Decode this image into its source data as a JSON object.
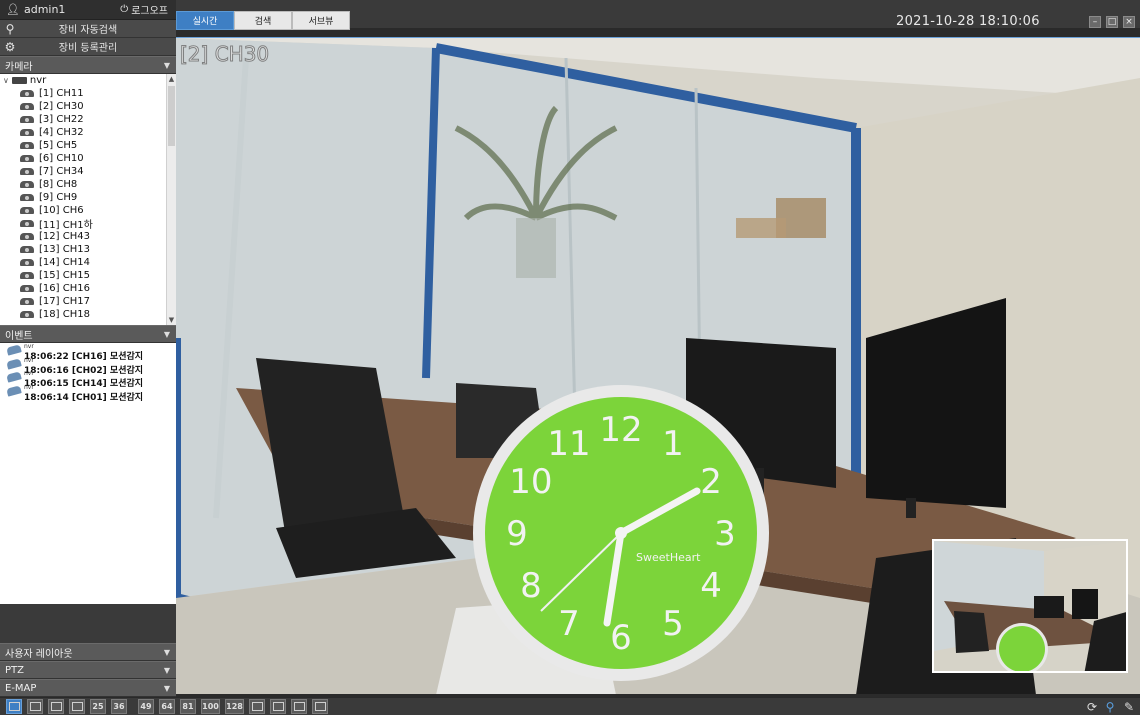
{
  "user": {
    "name": "admin1",
    "logout": "로그오프"
  },
  "menu": [
    {
      "label": "장비 자동검색",
      "icon": "search-icon"
    },
    {
      "label": "장비 등록관리",
      "icon": "gear-icon"
    }
  ],
  "camera": {
    "header": "카메라",
    "root": "nvr",
    "items": [
      "[1] CH11",
      "[2] CH30",
      "[3] CH22",
      "[4] CH32",
      "[5] CH5",
      "[6] CH10",
      "[7] CH34",
      "[8] CH8",
      "[9] CH9",
      "[10] CH6",
      "[11] CH1하",
      "[12] CH43",
      "[13] CH13",
      "[14] CH14",
      "[15] CH15",
      "[16] CH16",
      "[17] CH17",
      "[18] CH18"
    ]
  },
  "events": {
    "header": "이벤트",
    "items": [
      {
        "src": "nvr",
        "text": "18:06:22 [CH16] 모션감지"
      },
      {
        "src": "nvr",
        "text": "18:06:16 [CH02] 모션감지"
      },
      {
        "src": "nvr",
        "text": "18:06:15 [CH14] 모션감지"
      },
      {
        "src": "nvr",
        "text": "18:06:14 [CH01] 모션감지"
      }
    ]
  },
  "panels": [
    "사용자 레이아웃",
    "PTZ",
    "E-MAP"
  ],
  "tabs": [
    {
      "label": "실시간",
      "active": true
    },
    {
      "label": "검색",
      "active": false
    },
    {
      "label": "서브뷰",
      "active": false
    }
  ],
  "datetime": "2021-10-28 18:10:06",
  "video": {
    "channel_label": "[2] CH30",
    "clock_brand": "SweetHeart"
  },
  "clock_numbers": [
    "12",
    "1",
    "2",
    "3",
    "4",
    "5",
    "6",
    "7",
    "8",
    "9",
    "10",
    "11"
  ],
  "layouts": [
    "",
    "",
    "",
    "",
    "25",
    "36",
    "49",
    "64",
    "81",
    "100",
    "128",
    "",
    "",
    "",
    ""
  ],
  "colors": {
    "accent": "#3e7fc4",
    "sidebar": "#3a3a3a",
    "clock_face": "#7cd43a"
  }
}
